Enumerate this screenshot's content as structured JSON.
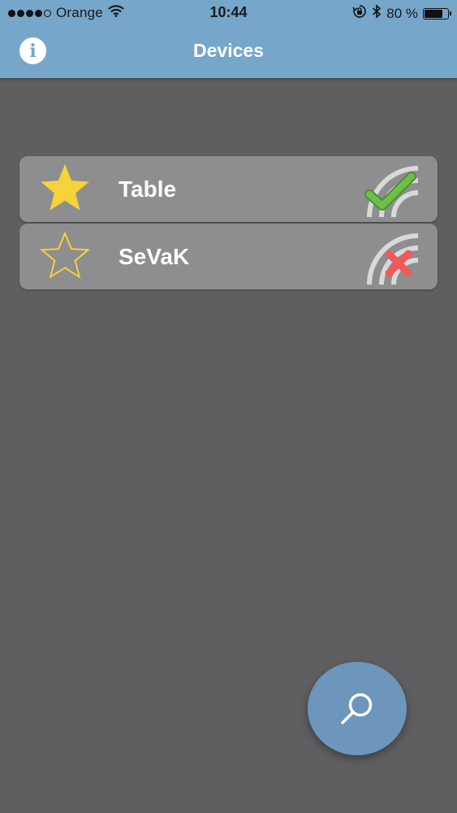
{
  "status_bar": {
    "carrier": "Orange",
    "signal_bars": 4,
    "signal_bars_total": 5,
    "time": "10:44",
    "battery_text": "80 %",
    "battery_level": 0.8,
    "icons": [
      "wifi-icon",
      "orientation-lock-icon",
      "bluetooth-icon",
      "battery-icon"
    ]
  },
  "nav": {
    "title": "Devices",
    "info_icon": "info-icon",
    "info_glyph": "i"
  },
  "devices": [
    {
      "name": "Table",
      "favorite": true,
      "connected": true,
      "star_icon": "star-filled-icon",
      "status_icon": "connected-check-icon"
    },
    {
      "name": "SeVaK",
      "favorite": false,
      "connected": false,
      "star_icon": "star-outline-icon",
      "status_icon": "disconnected-x-icon"
    }
  ],
  "fab": {
    "icon": "search-icon"
  },
  "colors": {
    "nav_bar": "#76a6c9",
    "background": "#5f5e60",
    "row": "#8e8d8f",
    "star": "#f6d23a",
    "check": "#6cc04a",
    "cross": "#ee5a5a",
    "fab": "#6c96bb"
  }
}
